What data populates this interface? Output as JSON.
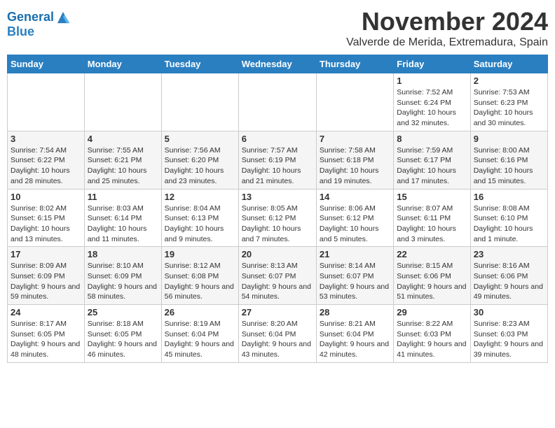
{
  "logo": {
    "line1": "General",
    "line2": "Blue"
  },
  "title": "November 2024",
  "subtitle": "Valverde de Merida, Extremadura, Spain",
  "days_of_week": [
    "Sunday",
    "Monday",
    "Tuesday",
    "Wednesday",
    "Thursday",
    "Friday",
    "Saturday"
  ],
  "weeks": [
    [
      {
        "day": "",
        "detail": ""
      },
      {
        "day": "",
        "detail": ""
      },
      {
        "day": "",
        "detail": ""
      },
      {
        "day": "",
        "detail": ""
      },
      {
        "day": "",
        "detail": ""
      },
      {
        "day": "1",
        "detail": "Sunrise: 7:52 AM\nSunset: 6:24 PM\nDaylight: 10 hours and 32 minutes."
      },
      {
        "day": "2",
        "detail": "Sunrise: 7:53 AM\nSunset: 6:23 PM\nDaylight: 10 hours and 30 minutes."
      }
    ],
    [
      {
        "day": "3",
        "detail": "Sunrise: 7:54 AM\nSunset: 6:22 PM\nDaylight: 10 hours and 28 minutes."
      },
      {
        "day": "4",
        "detail": "Sunrise: 7:55 AM\nSunset: 6:21 PM\nDaylight: 10 hours and 25 minutes."
      },
      {
        "day": "5",
        "detail": "Sunrise: 7:56 AM\nSunset: 6:20 PM\nDaylight: 10 hours and 23 minutes."
      },
      {
        "day": "6",
        "detail": "Sunrise: 7:57 AM\nSunset: 6:19 PM\nDaylight: 10 hours and 21 minutes."
      },
      {
        "day": "7",
        "detail": "Sunrise: 7:58 AM\nSunset: 6:18 PM\nDaylight: 10 hours and 19 minutes."
      },
      {
        "day": "8",
        "detail": "Sunrise: 7:59 AM\nSunset: 6:17 PM\nDaylight: 10 hours and 17 minutes."
      },
      {
        "day": "9",
        "detail": "Sunrise: 8:00 AM\nSunset: 6:16 PM\nDaylight: 10 hours and 15 minutes."
      }
    ],
    [
      {
        "day": "10",
        "detail": "Sunrise: 8:02 AM\nSunset: 6:15 PM\nDaylight: 10 hours and 13 minutes."
      },
      {
        "day": "11",
        "detail": "Sunrise: 8:03 AM\nSunset: 6:14 PM\nDaylight: 10 hours and 11 minutes."
      },
      {
        "day": "12",
        "detail": "Sunrise: 8:04 AM\nSunset: 6:13 PM\nDaylight: 10 hours and 9 minutes."
      },
      {
        "day": "13",
        "detail": "Sunrise: 8:05 AM\nSunset: 6:12 PM\nDaylight: 10 hours and 7 minutes."
      },
      {
        "day": "14",
        "detail": "Sunrise: 8:06 AM\nSunset: 6:12 PM\nDaylight: 10 hours and 5 minutes."
      },
      {
        "day": "15",
        "detail": "Sunrise: 8:07 AM\nSunset: 6:11 PM\nDaylight: 10 hours and 3 minutes."
      },
      {
        "day": "16",
        "detail": "Sunrise: 8:08 AM\nSunset: 6:10 PM\nDaylight: 10 hours and 1 minute."
      }
    ],
    [
      {
        "day": "17",
        "detail": "Sunrise: 8:09 AM\nSunset: 6:09 PM\nDaylight: 9 hours and 59 minutes."
      },
      {
        "day": "18",
        "detail": "Sunrise: 8:10 AM\nSunset: 6:09 PM\nDaylight: 9 hours and 58 minutes."
      },
      {
        "day": "19",
        "detail": "Sunrise: 8:12 AM\nSunset: 6:08 PM\nDaylight: 9 hours and 56 minutes."
      },
      {
        "day": "20",
        "detail": "Sunrise: 8:13 AM\nSunset: 6:07 PM\nDaylight: 9 hours and 54 minutes."
      },
      {
        "day": "21",
        "detail": "Sunrise: 8:14 AM\nSunset: 6:07 PM\nDaylight: 9 hours and 53 minutes."
      },
      {
        "day": "22",
        "detail": "Sunrise: 8:15 AM\nSunset: 6:06 PM\nDaylight: 9 hours and 51 minutes."
      },
      {
        "day": "23",
        "detail": "Sunrise: 8:16 AM\nSunset: 6:06 PM\nDaylight: 9 hours and 49 minutes."
      }
    ],
    [
      {
        "day": "24",
        "detail": "Sunrise: 8:17 AM\nSunset: 6:05 PM\nDaylight: 9 hours and 48 minutes."
      },
      {
        "day": "25",
        "detail": "Sunrise: 8:18 AM\nSunset: 6:05 PM\nDaylight: 9 hours and 46 minutes."
      },
      {
        "day": "26",
        "detail": "Sunrise: 8:19 AM\nSunset: 6:04 PM\nDaylight: 9 hours and 45 minutes."
      },
      {
        "day": "27",
        "detail": "Sunrise: 8:20 AM\nSunset: 6:04 PM\nDaylight: 9 hours and 43 minutes."
      },
      {
        "day": "28",
        "detail": "Sunrise: 8:21 AM\nSunset: 6:04 PM\nDaylight: 9 hours and 42 minutes."
      },
      {
        "day": "29",
        "detail": "Sunrise: 8:22 AM\nSunset: 6:03 PM\nDaylight: 9 hours and 41 minutes."
      },
      {
        "day": "30",
        "detail": "Sunrise: 8:23 AM\nSunset: 6:03 PM\nDaylight: 9 hours and 39 minutes."
      }
    ]
  ]
}
